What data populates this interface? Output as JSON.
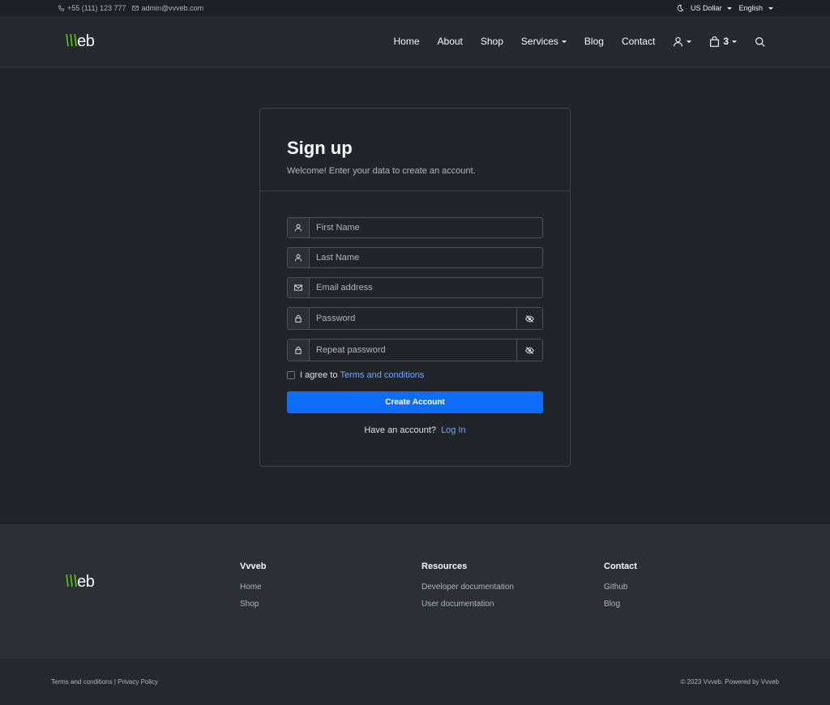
{
  "topbar": {
    "phone": "+55 (111) 123 777",
    "email": "admin@vvveb.com",
    "currency": "US Dollar",
    "language": "English"
  },
  "brand": {
    "slashes": "\\\\\\",
    "rest": "eb"
  },
  "nav": {
    "items": [
      "Home",
      "About",
      "Shop",
      "Services",
      "Blog",
      "Contact"
    ],
    "cart_count": "3"
  },
  "signup": {
    "title": "Sign up",
    "subtitle": "Welcome! Enter your data to create an account.",
    "first_name_placeholder": "First Name",
    "last_name_placeholder": "Last Name",
    "email_placeholder": "Email address",
    "password_placeholder": "Password",
    "repeat_password_placeholder": "Repeat password",
    "agree_text": "I agree to",
    "terms_link": "Terms and conditions",
    "submit_label": "Create Account",
    "have_account": "Have an account?",
    "login_link": "Log In"
  },
  "footer": {
    "columns": [
      {
        "title": "Vvveb",
        "links": [
          "Home",
          "Shop"
        ]
      },
      {
        "title": "Resources",
        "links": [
          "Developer documentation",
          "User documentation"
        ]
      },
      {
        "title": "Contact",
        "links": [
          "Github",
          "Blog"
        ]
      }
    ],
    "terms": "Terms and conditions",
    "separator": "|",
    "privacy": "Privacy Policy",
    "copyright": "© 2023 Vvveb. Powered by Vvveb"
  },
  "colors": {
    "accent": "#0d6efd",
    "link": "#6ea8fe",
    "brand_green": "#5fd31a",
    "background": "#212529"
  }
}
